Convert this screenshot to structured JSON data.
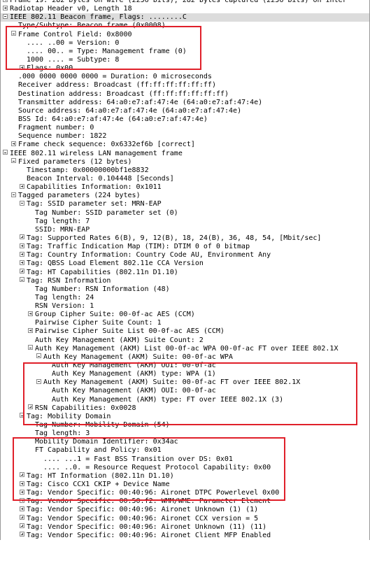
{
  "rows": [
    {
      "indent": 0,
      "toggle": "collapsed",
      "text": "Frame 19: 282 bytes on wire (2256 bits), 282 bytes captured (2256 bits) on inter"
    },
    {
      "indent": 0,
      "toggle": "collapsed",
      "text": "Radiotap Header v0, Length 18"
    },
    {
      "indent": 0,
      "toggle": "expanded",
      "text": "IEEE 802.11 Beacon frame, Flags: ........C"
    },
    {
      "indent": 1,
      "toggle": "none",
      "text": "Type/Subtype: Beacon frame (0x0008)"
    },
    {
      "indent": 1,
      "toggle": "expanded",
      "text": "Frame Control Field: 0x8000"
    },
    {
      "indent": 2,
      "toggle": "none",
      "text": ".... ..00 = Version: 0"
    },
    {
      "indent": 2,
      "toggle": "none",
      "text": ".... 00.. = Type: Management frame (0)"
    },
    {
      "indent": 2,
      "toggle": "none",
      "text": "1000 .... = Subtype: 8"
    },
    {
      "indent": 2,
      "toggle": "collapsed",
      "text": "Flags: 0x00"
    },
    {
      "indent": 1,
      "toggle": "none",
      "text": ".000 0000 0000 0000 = Duration: 0 microseconds"
    },
    {
      "indent": 1,
      "toggle": "none",
      "text": "Receiver address: Broadcast (ff:ff:ff:ff:ff:ff)"
    },
    {
      "indent": 1,
      "toggle": "none",
      "text": "Destination address: Broadcast (ff:ff:ff:ff:ff:ff)"
    },
    {
      "indent": 1,
      "toggle": "none",
      "text": "Transmitter address: 64:a0:e7:af:47:4e (64:a0:e7:af:47:4e)"
    },
    {
      "indent": 1,
      "toggle": "none",
      "text": "Source address: 64:a0:e7:af:47:4e (64:a0:e7:af:47:4e)"
    },
    {
      "indent": 1,
      "toggle": "none",
      "text": "BSS Id: 64:a0:e7:af:47:4e (64:a0:e7:af:47:4e)"
    },
    {
      "indent": 1,
      "toggle": "none",
      "text": "Fragment number: 0"
    },
    {
      "indent": 1,
      "toggle": "none",
      "text": "Sequence number: 1822"
    },
    {
      "indent": 1,
      "toggle": "collapsed",
      "text": "Frame check sequence: 0x6332ef6b [correct]"
    },
    {
      "indent": 0,
      "toggle": "expanded",
      "text": "IEEE 802.11 wireless LAN management frame"
    },
    {
      "indent": 1,
      "toggle": "expanded",
      "text": "Fixed parameters (12 bytes)"
    },
    {
      "indent": 2,
      "toggle": "none",
      "text": "Timestamp: 0x00000000bf1e8832"
    },
    {
      "indent": 2,
      "toggle": "none",
      "text": "Beacon Interval: 0.104448 [Seconds]"
    },
    {
      "indent": 2,
      "toggle": "collapsed",
      "text": "Capabilities Information: 0x1011"
    },
    {
      "indent": 1,
      "toggle": "expanded",
      "text": "Tagged parameters (224 bytes)"
    },
    {
      "indent": 2,
      "toggle": "expanded",
      "text": "Tag: SSID parameter set: MRN-EAP"
    },
    {
      "indent": 3,
      "toggle": "none",
      "text": "Tag Number: SSID parameter set (0)"
    },
    {
      "indent": 3,
      "toggle": "none",
      "text": "Tag length: 7"
    },
    {
      "indent": 3,
      "toggle": "none",
      "text": "SSID: MRN-EAP"
    },
    {
      "indent": 2,
      "toggle": "collapsed",
      "text": "Tag: Supported Rates 6(B), 9, 12(B), 18, 24(B), 36, 48, 54, [Mbit/sec]"
    },
    {
      "indent": 2,
      "toggle": "collapsed",
      "text": "Tag: Traffic Indication Map (TIM): DTIM 0 of 0 bitmap"
    },
    {
      "indent": 2,
      "toggle": "collapsed",
      "text": "Tag: Country Information: Country Code AU, Environment Any"
    },
    {
      "indent": 2,
      "toggle": "collapsed",
      "text": "Tag: QBSS Load Element 802.11e CCA Version"
    },
    {
      "indent": 2,
      "toggle": "collapsed",
      "text": "Tag: HT Capabilities (802.11n D1.10)"
    },
    {
      "indent": 2,
      "toggle": "expanded",
      "text": "Tag: RSN Information"
    },
    {
      "indent": 3,
      "toggle": "none",
      "text": "Tag Number: RSN Information (48)"
    },
    {
      "indent": 3,
      "toggle": "none",
      "text": "Tag length: 24"
    },
    {
      "indent": 3,
      "toggle": "none",
      "text": "RSN Version: 1"
    },
    {
      "indent": 3,
      "toggle": "collapsed",
      "text": "Group Cipher Suite: 00-0f-ac AES (CCM)"
    },
    {
      "indent": 3,
      "toggle": "none",
      "text": "Pairwise Cipher Suite Count: 1"
    },
    {
      "indent": 3,
      "toggle": "collapsed",
      "text": "Pairwise Cipher Suite List 00-0f-ac AES (CCM)"
    },
    {
      "indent": 3,
      "toggle": "none",
      "text": "Auth Key Management (AKM) Suite Count: 2"
    },
    {
      "indent": 3,
      "toggle": "expanded",
      "text": "Auth Key Management (AKM) List 00-0f-ac WPA 00-0f-ac FT over IEEE 802.1X"
    },
    {
      "indent": 4,
      "toggle": "expanded",
      "text": "Auth Key Management (AKM) Suite: 00-0f-ac WPA"
    },
    {
      "indent": 5,
      "toggle": "none",
      "text": "Auth Key Management (AKM) OUI: 00-0f-ac"
    },
    {
      "indent": 5,
      "toggle": "none",
      "text": "Auth Key Management (AKM) type: WPA (1)"
    },
    {
      "indent": 4,
      "toggle": "expanded",
      "text": "Auth Key Management (AKM) Suite: 00-0f-ac FT over IEEE 802.1X"
    },
    {
      "indent": 5,
      "toggle": "none",
      "text": "Auth Key Management (AKM) OUI: 00-0f-ac"
    },
    {
      "indent": 5,
      "toggle": "none",
      "text": "Auth Key Management (AKM) type: FT over IEEE 802.1X (3)"
    },
    {
      "indent": 3,
      "toggle": "collapsed",
      "text": "RSN Capabilities: 0x0028"
    },
    {
      "indent": 2,
      "toggle": "expanded",
      "text": "Tag: Mobility Domain"
    },
    {
      "indent": 3,
      "toggle": "none",
      "text": "Tag Number: Mobility Domain (54)"
    },
    {
      "indent": 3,
      "toggle": "none",
      "text": "Tag length: 3"
    },
    {
      "indent": 3,
      "toggle": "none",
      "text": "Mobility Domain Identifier: 0x34ac"
    },
    {
      "indent": 3,
      "toggle": "none",
      "text": "FT Capability and Policy: 0x01"
    },
    {
      "indent": 4,
      "toggle": "none",
      "text": ".... ...1 = Fast BSS Transition over DS: 0x01"
    },
    {
      "indent": 4,
      "toggle": "none",
      "text": ".... ..0. = Resource Request Protocol Capability: 0x00"
    },
    {
      "indent": 2,
      "toggle": "collapsed",
      "text": "Tag: HT Information (802.11n D1.10)"
    },
    {
      "indent": 2,
      "toggle": "collapsed",
      "text": "Tag: Cisco CCX1 CKIP + Device Name"
    },
    {
      "indent": 2,
      "toggle": "collapsed",
      "text": "Tag: Vendor Specific: 00:40:96: Aironet DTPC Powerlevel 0x00"
    },
    {
      "indent": 2,
      "toggle": "collapsed",
      "text": "Tag: Vendor Specific: 00:50:f2: WMM/WME: Parameter Element"
    },
    {
      "indent": 2,
      "toggle": "collapsed",
      "text": "Tag: Vendor Specific: 00:40:96: Aironet Unknown (1) (1)"
    },
    {
      "indent": 2,
      "toggle": "collapsed",
      "text": "Tag: Vendor Specific: 00:40:96: Aironet CCX version = 5"
    },
    {
      "indent": 2,
      "toggle": "collapsed",
      "text": "Tag: Vendor Specific: 00:40:96: Aironet Unknown (11) (11)"
    },
    {
      "indent": 2,
      "toggle": "collapsed",
      "text": "Tag: Vendor Specific: 00:40:96: Aironet Client MFP Enabled"
    }
  ],
  "selected_row": 2,
  "highlight_color": "#e0202a"
}
